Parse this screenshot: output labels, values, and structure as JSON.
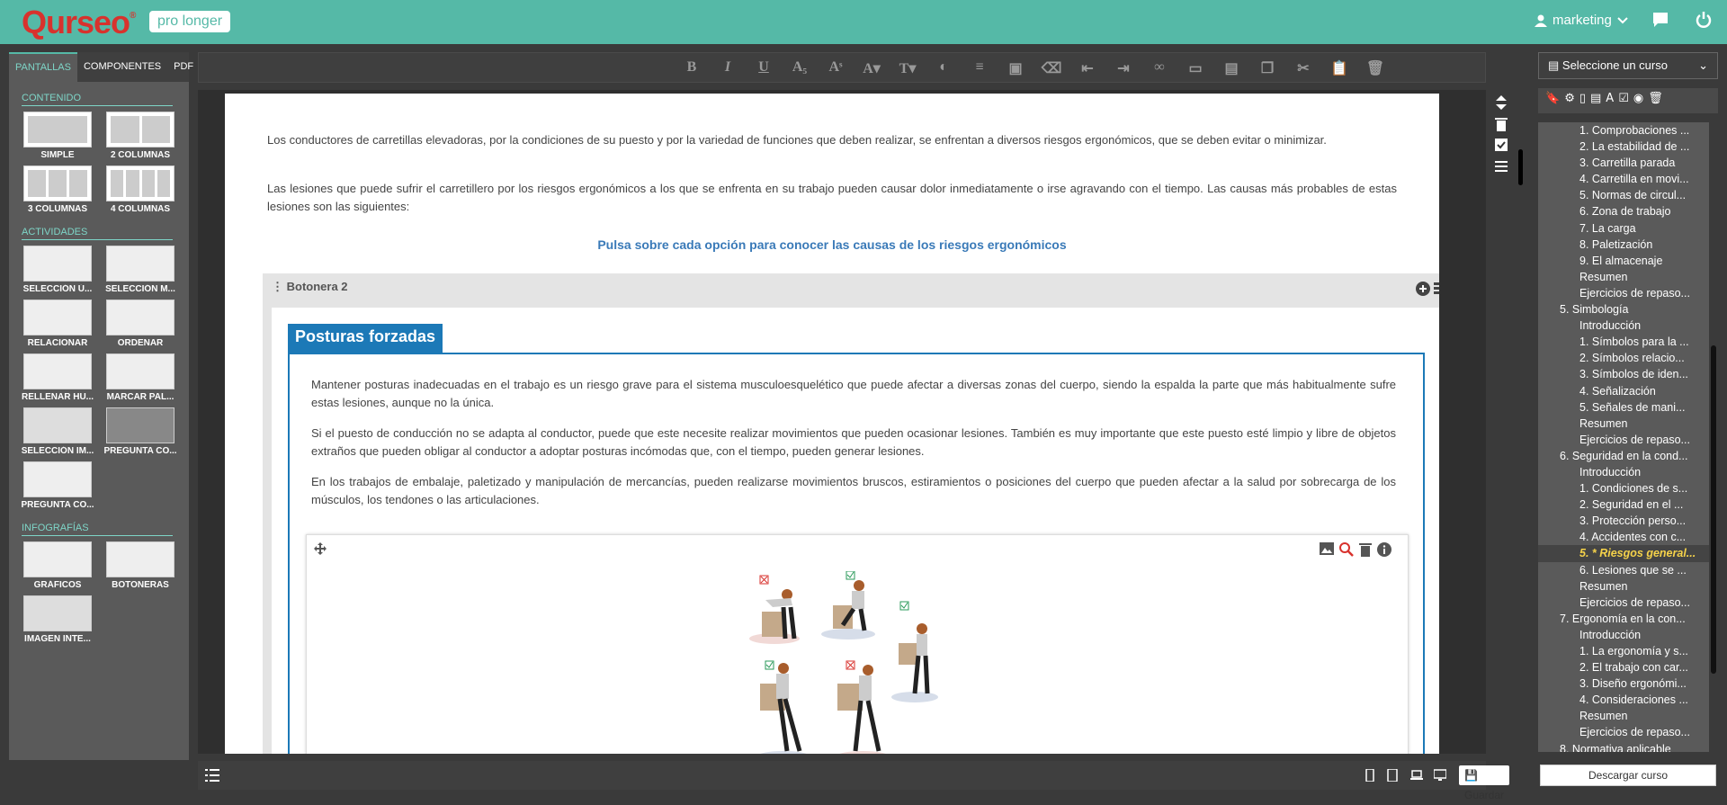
{
  "header": {
    "logo": "Qurseo",
    "logo_mark": "®",
    "badge": "pro longer",
    "user": "marketing"
  },
  "left": {
    "tabs": [
      "PANTALLAS",
      "COMPONENTES",
      "PDF"
    ],
    "sections": {
      "contenido": "CONTENIDO",
      "actividades": "ACTIVIDADES",
      "infografias": "INFOGRAFÍAS"
    },
    "contenido": [
      "SIMPLE",
      "2 COLUMNAS",
      "3 COLUMNAS",
      "4 COLUMNAS"
    ],
    "actividades": [
      "SELECCIÓN Ú...",
      "SELECCIÓN M...",
      "RELACIONAR",
      "ORDENAR",
      "RELLENAR HU...",
      "MARCAR PAL...",
      "SELECCIÓN IM...",
      "PREGUNTA CO...",
      "PREGUNTA CO..."
    ],
    "infografias": [
      "GRÁFICOS",
      "BOTONERAS",
      "IMAGEN INTE..."
    ]
  },
  "content": {
    "p1": "Los conductores de carretillas elevadoras, por la condiciones de su puesto y por la variedad de funciones que deben realizar, se enfrentan a diversos riesgos ergonómicos, que se deben evitar o minimizar.",
    "p2": "Las lesiones que puede sufrir el carretillero por los riesgos ergonómicos a los que se enfrenta en su trabajo pueden causar dolor inmediatamente o irse agravando con el tiempo. Las causas más probables de estas lesiones son las siguientes:",
    "cta": "Pulsa sobre cada opción para conocer las causas de los riesgos ergonómicos",
    "botonera_title": "Botonera 2",
    "tab_title": "Posturas forzadas",
    "b1": "Mantener posturas inadecuadas en el trabajo es un riesgo grave para el sistema musculoesquelético que puede afectar a diversas zonas del cuerpo, siendo la espalda la parte que más habitualmente sufre estas lesiones, aunque no la única.",
    "b2": "Si el puesto de conducción no se adapta al conductor, puede que este necesite realizar movimientos que pueden ocasionar lesiones. También es muy importante que este puesto esté limpio y libre de objetos extraños que pueden obligar al conductor a adoptar posturas incómodas que, con el tiempo, pueden generar lesiones.",
    "b3": "En los trabajos de embalaje, paletizado y manipulación de mercancías, pueden realizarse movimientos bruscos, estiramientos o posiciones del cuerpo que pueden afectar a la salud por sobrecarga de los músculos, los tendones o las articulaciones."
  },
  "bottom": {
    "save": "Guardar"
  },
  "right": {
    "select": "Seleccione un curso",
    "tree": [
      "1. Comprobaciones ...",
      "2. La estabilidad de ...",
      "3. Carretilla parada",
      "4. Carretilla en movi...",
      "5. Normas de circul...",
      "6. Zona de trabajo",
      "7. La carga",
      "8. Paletización",
      "9. El almacenaje",
      "Resumen",
      "Ejercicios de repaso...",
      "5. Simbología",
      "Introducción",
      "1. Símbolos para la ...",
      "2. Símbolos relacio...",
      "3. Símbolos de iden...",
      "4. Señalización",
      "5. Señales de mani...",
      "Resumen",
      "Ejercicios de repaso...",
      "6. Seguridad en la cond...",
      "Introducción",
      "1. Condiciones de s...",
      "2. Seguridad en el ...",
      "3. Protección perso...",
      "4. Accidentes con c...",
      "5. * Riesgos general...",
      "6. Lesiones que se ...",
      "Resumen",
      "Ejercicios de repaso...",
      "7. Ergonomía en la con...",
      "Introducción",
      "1. La ergonomía y s...",
      "2. El trabajo con car...",
      "3. Diseño ergonómi...",
      "4. Consideraciones ...",
      "Resumen",
      "Ejercicios de repaso...",
      "8. Normativa aplicable"
    ],
    "download": "Descargar curso"
  },
  "colors": {
    "brand": "#55b9a7",
    "logo": "#d8322d",
    "accent_blue": "#1c79b7",
    "active_item": "#f5d24a"
  }
}
